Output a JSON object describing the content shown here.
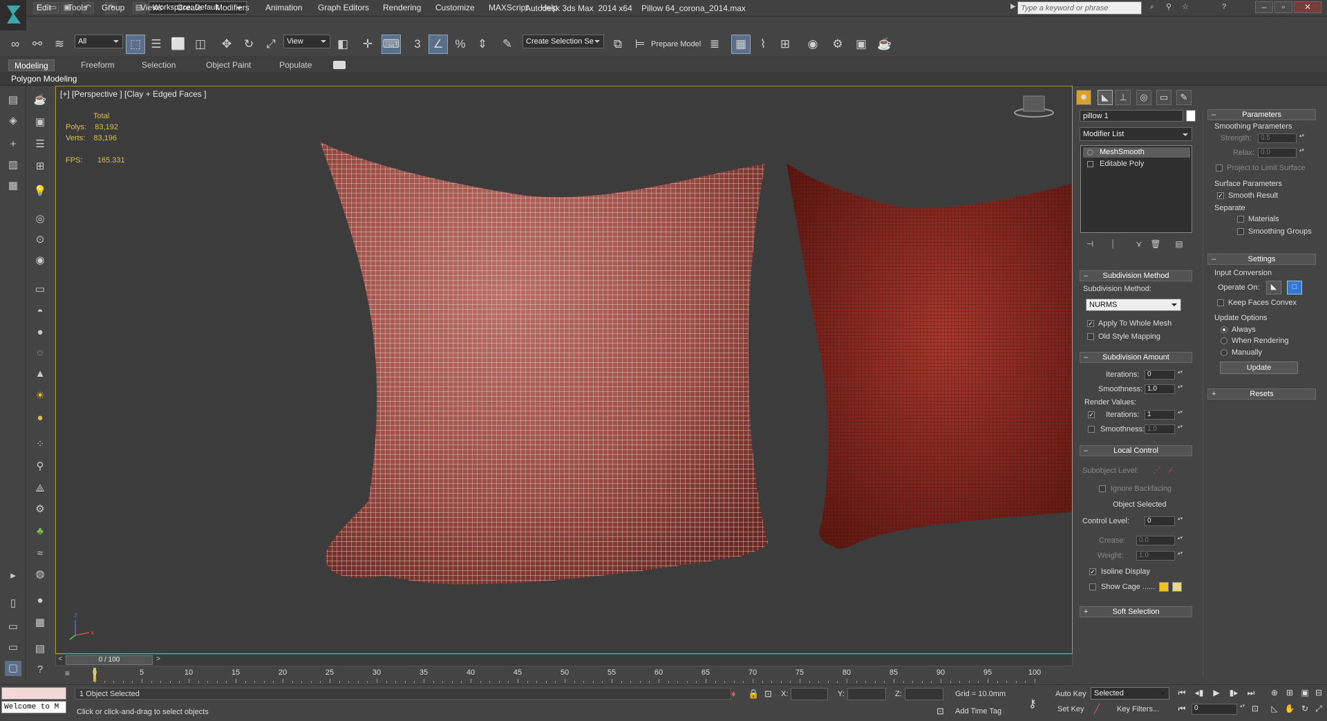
{
  "title_bar": {
    "workspace": "Workspace: Default",
    "app_title": "Autodesk 3ds Max  2014 x64",
    "file_name": "Pillow 64_corona_2014.max",
    "search_placeholder": "Type a keyword or phrase"
  },
  "menu": [
    "Edit",
    "Tools",
    "Group",
    "Views",
    "Create",
    "Modifiers",
    "Animation",
    "Graph Editors",
    "Rendering",
    "Customize",
    "MAXScript",
    "Help"
  ],
  "toolbar": {
    "selection_filter": "All",
    "reference_coord": "View",
    "named_selection": "Create Selection Se",
    "prepare_model": "Prepare Model",
    "snap_3": "3",
    "snap_percent": "%"
  },
  "ribbon": {
    "tabs": [
      "Modeling",
      "Freeform",
      "Selection",
      "Object Paint",
      "Populate"
    ],
    "active_tab": "Modeling",
    "panel_label": "Polygon Modeling"
  },
  "viewport": {
    "label": "[+] [Perspective ] [Clay + Edged Faces ]",
    "stats": {
      "header": "Total",
      "polys_label": "Polys:",
      "polys": "83,192",
      "verts_label": "Verts:",
      "verts": "83,196",
      "fps_label": "FPS:",
      "fps": "165.331"
    },
    "axis": {
      "x": "x",
      "z": "z"
    }
  },
  "command_panel": {
    "object_name": "pillow 1",
    "modifier_list": "Modifier List",
    "stack": [
      "MeshSmooth",
      "Editable Poly"
    ],
    "subdivision_method": {
      "title": "Subdivision Method",
      "method_label": "Subdivision Method:",
      "method": "NURMS",
      "apply_whole": "Apply To Whole Mesh",
      "old_style": "Old Style Mapping"
    },
    "subdivision_amount": {
      "title": "Subdivision Amount",
      "iterations_label": "Iterations:",
      "iterations": "0",
      "smoothness_label": "Smoothness:",
      "smoothness": "1.0",
      "render_values": "Render Values:",
      "r_iterations_label": "Iterations:",
      "r_iterations": "1",
      "r_smoothness_label": "Smoothness:",
      "r_smoothness": "1.0"
    },
    "local_control": {
      "title": "Local Control",
      "subobject_label": "Subobject Level:",
      "ignore_backfacing": "Ignore Backfacing",
      "object_selected": "Object Selected",
      "control_level_label": "Control Level:",
      "control_level": "0",
      "crease_label": "Crease:",
      "crease": "0.0",
      "weight_label": "Weight:",
      "weight": "1.0",
      "isoline": "Isoline Display",
      "show_cage": "Show Cage ......",
      "cage_color_1": "#f0c419",
      "cage_color_2": "#e8d98a"
    },
    "soft_selection": "Soft Selection",
    "parameters": {
      "title": "Parameters",
      "smoothing_params": "Smoothing Parameters",
      "strength_label": "Strength:",
      "strength": "0.5",
      "relax_label": "Relax:",
      "relax": "0.0",
      "project": "Project to Limit Surface",
      "surface_params": "Surface Parameters",
      "smooth_result": "Smooth Result",
      "separate": "Separate",
      "materials": "Materials",
      "smoothing_groups": "Smoothing Groups"
    },
    "settings": {
      "title": "Settings",
      "input_conversion": "Input Conversion",
      "operate_on": "Operate On:",
      "keep_faces_convex": "Keep Faces Convex",
      "update_options": "Update Options",
      "always": "Always",
      "when_rendering": "When Rendering",
      "manually": "Manually",
      "update": "Update"
    },
    "resets": "Resets"
  },
  "timeline": {
    "slider": "0 / 100",
    "ticks": [
      "0",
      "5",
      "10",
      "15",
      "20",
      "25",
      "30",
      "35",
      "40",
      "45",
      "50",
      "55",
      "60",
      "65",
      "70",
      "75",
      "80",
      "85",
      "90",
      "95",
      "100"
    ]
  },
  "status": {
    "welcome": "Welcome to M",
    "selected": "1 Object Selected",
    "prompt": "Click or click-and-drag to select objects",
    "x_label": "X:",
    "y_label": "Y:",
    "z_label": "Z:",
    "grid": "Grid = 10.0mm",
    "add_time_tag": "Add Time Tag",
    "auto_key": "Auto Key",
    "auto_key_mode": "Selected",
    "set_key": "Set Key",
    "key_filters": "Key Filters...",
    "frame": "0"
  },
  "colors": {
    "pillow_front": "#a85a52",
    "pillow_back": "#8c2a22",
    "viewport_border": "#b79a3c",
    "stats": "#d8c24a"
  }
}
